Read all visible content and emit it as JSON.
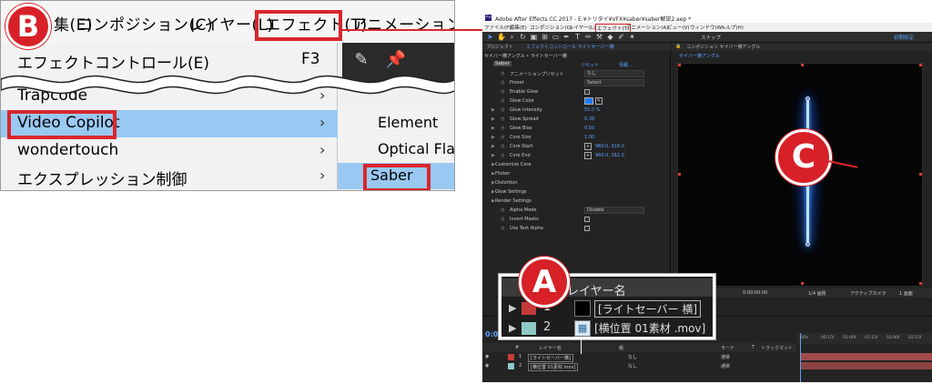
{
  "badges": {
    "b": "B",
    "c": "C",
    "a": "A"
  },
  "menubar": {
    "edit_partial": "集(E)",
    "items": [
      "コンポジション(C)",
      "レイヤー(L)",
      "エフェクト(T)",
      "アニメーション(A)"
    ]
  },
  "menu": {
    "effect_controls": "エフェクトコントロール(E)",
    "effect_controls_shortcut": "F3",
    "trapcode": "Trapcode",
    "video_copilot": "Video Copilot",
    "wondertouch": "wondertouch",
    "expression_controls": "エクスプレッション制御",
    "arrow": "›"
  },
  "submenu": {
    "items": [
      "Element",
      "Optical Flares",
      "Saber"
    ]
  },
  "ae_toolbar_icons": [
    "pin-tool-icon",
    "pushpin-icon"
  ],
  "ae": {
    "title": "Adobe After Effects CC 2017 - E:¥トリタイ¥VFX¥saber¥saber解説2.aep *",
    "app_icon": "Ae",
    "menubar": [
      "ファイル(F)",
      "編集(E)",
      "コンポジション(C)",
      "レイヤー(L)",
      "エフェクト(T)",
      "アニメーション(A)",
      "ビュー(V)",
      "ウィンドウ(W)",
      "ヘルプ(H)"
    ],
    "snap_label": "スナップ",
    "workspace_label": "初期設定",
    "fx_tabs": [
      "プロジェクト",
      "エフェクトコントロール ライトセーバー横"
    ],
    "fx_sub": "セイバー横アングル • ライトセーバー横",
    "fx_name": "Saber",
    "fx_reset": "リセット",
    "fx_about": "情報...",
    "fx_rows": [
      {
        "label": "アニメーションプリセット",
        "kind": "dd",
        "value": "なし"
      },
      {
        "label": "Preset",
        "kind": "dd",
        "value": "Select"
      },
      {
        "label": "Enable Glow",
        "kind": "chk",
        "value": ""
      },
      {
        "label": "Glow Color",
        "kind": "color",
        "value": ""
      },
      {
        "label": "Glow Intensity",
        "kind": "val",
        "value": "55.0 %"
      },
      {
        "label": "Glow Spread",
        "kind": "val",
        "value": "0.38"
      },
      {
        "label": "Glow Bias",
        "kind": "val",
        "value": "0.50"
      },
      {
        "label": "Core Size",
        "kind": "val",
        "value": "1.00"
      },
      {
        "label": "Core Start",
        "kind": "pt",
        "value": "960.0, 918.0"
      },
      {
        "label": "Core End",
        "kind": "pt",
        "value": "960.0, 162.0"
      },
      {
        "label": "Customize Core",
        "kind": "section",
        "value": ""
      },
      {
        "label": "Flicker",
        "kind": "section",
        "value": ""
      },
      {
        "label": "Distortion",
        "kind": "section",
        "value": ""
      },
      {
        "label": "Glow Settings",
        "kind": "section",
        "value": ""
      },
      {
        "label": "Render Settings",
        "kind": "section",
        "value": ""
      },
      {
        "label": "Alpha Mode",
        "kind": "dd",
        "value": "Disable"
      },
      {
        "label": "Invert Masks",
        "kind": "chk",
        "value": ""
      },
      {
        "label": "Use Text Alpha",
        "kind": "chk",
        "value": ""
      }
    ],
    "comp_tab": "コンポジション セイバー横アングル",
    "comp_sub": "セイバー横アングル",
    "comp_footer": [
      "0:00:00:00",
      "1/4 画質",
      "アクティブカメラ",
      "1 画面"
    ],
    "timeline_time": "0:00",
    "tl_header": [
      "#",
      "レイヤー名",
      "親",
      "モード",
      "T",
      "トラックマット"
    ],
    "tl_rows": [
      {
        "num": "1",
        "name": "[ライトセーバー横]",
        "color": "#c53a3a",
        "parent": "なし",
        "mode": "通常"
      },
      {
        "num": "2",
        "name": "[横位置 01素材.mov]",
        "color": "#8ec9c4",
        "parent": "なし",
        "mode": "通常"
      }
    ],
    "ruler": [
      "00s",
      "00:15f",
      "01:00f",
      "01:15f",
      "02:00f",
      "02:15f"
    ]
  },
  "layer_zoom": {
    "header": "レイヤー名",
    "rows": [
      {
        "num": "1",
        "name": "[ライトセーバー 横]",
        "color": "#c53a3a",
        "selected": true
      },
      {
        "num": "2",
        "name": "[横位置 01素材 .mov]",
        "color": "#8ec9c4",
        "selected": false
      }
    ]
  },
  "colors": {
    "accent_red": "#d72027",
    "highlight_blue": "#99c9f2",
    "ae_blue": "#5aa2ff",
    "saber_blue": "#2a7bff"
  }
}
